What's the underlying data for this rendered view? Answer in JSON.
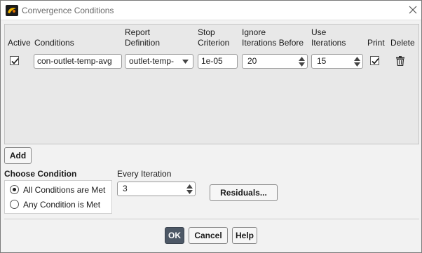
{
  "window": {
    "title": "Convergence Conditions",
    "icons": {
      "app": "ansys-fluent-icon",
      "close": "close-icon"
    }
  },
  "table": {
    "headers": {
      "active": "Active",
      "conditions": "Conditions",
      "report_definition": [
        "Report",
        "Definition"
      ],
      "stop_criterion": [
        "Stop",
        "Criterion"
      ],
      "ignore_iterations": [
        "Ignore",
        "Iterations Before"
      ],
      "use_iterations": [
        "Use",
        "Iterations"
      ],
      "print": "Print",
      "delete": "Delete"
    },
    "rows": [
      {
        "active": true,
        "condition": "con-outlet-temp-avg",
        "report_definition": "outlet-temp-",
        "stop_criterion": "1e-05",
        "ignore_iterations_before": "20",
        "use_iterations": "15",
        "print": true,
        "delete_icon": "trash-icon"
      }
    ]
  },
  "add_button": "Add",
  "choose_condition": {
    "label": "Choose Condition",
    "options": [
      "All Conditions are Met",
      "Any Condition is Met"
    ],
    "selected": "All Conditions are Met"
  },
  "every_iteration": {
    "label": "Every Iteration",
    "value": "3"
  },
  "residuals_button": "Residuals...",
  "footer": {
    "ok": "OK",
    "cancel": "Cancel",
    "help": "Help"
  },
  "colors": {
    "ok_button_bg": "#4d5866",
    "panel_bg": "#e8e8e8",
    "window_bg": "#f2f2f2"
  }
}
